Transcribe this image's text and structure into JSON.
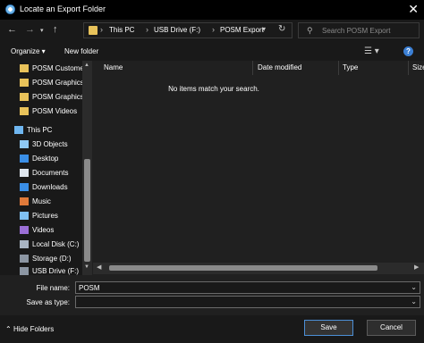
{
  "window": {
    "title": "Locate an Export Folder"
  },
  "nav": {
    "breadcrumbs": [
      "This PC",
      "USB Drive (F:)",
      "POSM Export"
    ],
    "search_placeholder": "Search POSM Export"
  },
  "toolbar": {
    "organize_label": "Organize ▾",
    "new_folder_label": "New folder"
  },
  "sidebar": {
    "items": [
      {
        "label": "POSM Customers",
        "icon": "posm-folder-icon"
      },
      {
        "label": "POSM Graphics",
        "icon": "posm-folder-icon"
      },
      {
        "label": "POSM Graphics",
        "icon": "posm-folder-icon"
      },
      {
        "label": "POSM Videos",
        "icon": "posm-folder-icon"
      },
      {
        "label": "This PC",
        "icon": "this-pc-icon"
      },
      {
        "label": "3D Objects",
        "icon": "3d-objects-icon"
      },
      {
        "label": "Desktop",
        "icon": "desktop-icon"
      },
      {
        "label": "Documents",
        "icon": "documents-icon"
      },
      {
        "label": "Downloads",
        "icon": "downloads-icon"
      },
      {
        "label": "Music",
        "icon": "music-icon"
      },
      {
        "label": "Pictures",
        "icon": "pictures-icon"
      },
      {
        "label": "Videos",
        "icon": "videos-icon"
      },
      {
        "label": "Local Disk (C:)",
        "icon": "local-disk-icon"
      },
      {
        "label": "Storage (D:)",
        "icon": "drive-icon"
      },
      {
        "label": "USB Drive (F:)",
        "icon": "usb-drive-icon"
      }
    ]
  },
  "content": {
    "columns": [
      "Name",
      "Date modified",
      "Type",
      "Size"
    ],
    "empty_message": "No items match your search."
  },
  "form": {
    "file_name_label": "File name:",
    "file_name_value": "POSM",
    "save_as_type_label": "Save as type:",
    "save_as_type_value": ""
  },
  "footer": {
    "hide_folders_label": "Hide Folders",
    "save_label": "Save",
    "cancel_label": "Cancel"
  },
  "colors": {
    "background": "#202020",
    "accent": "#4c8fd6"
  }
}
